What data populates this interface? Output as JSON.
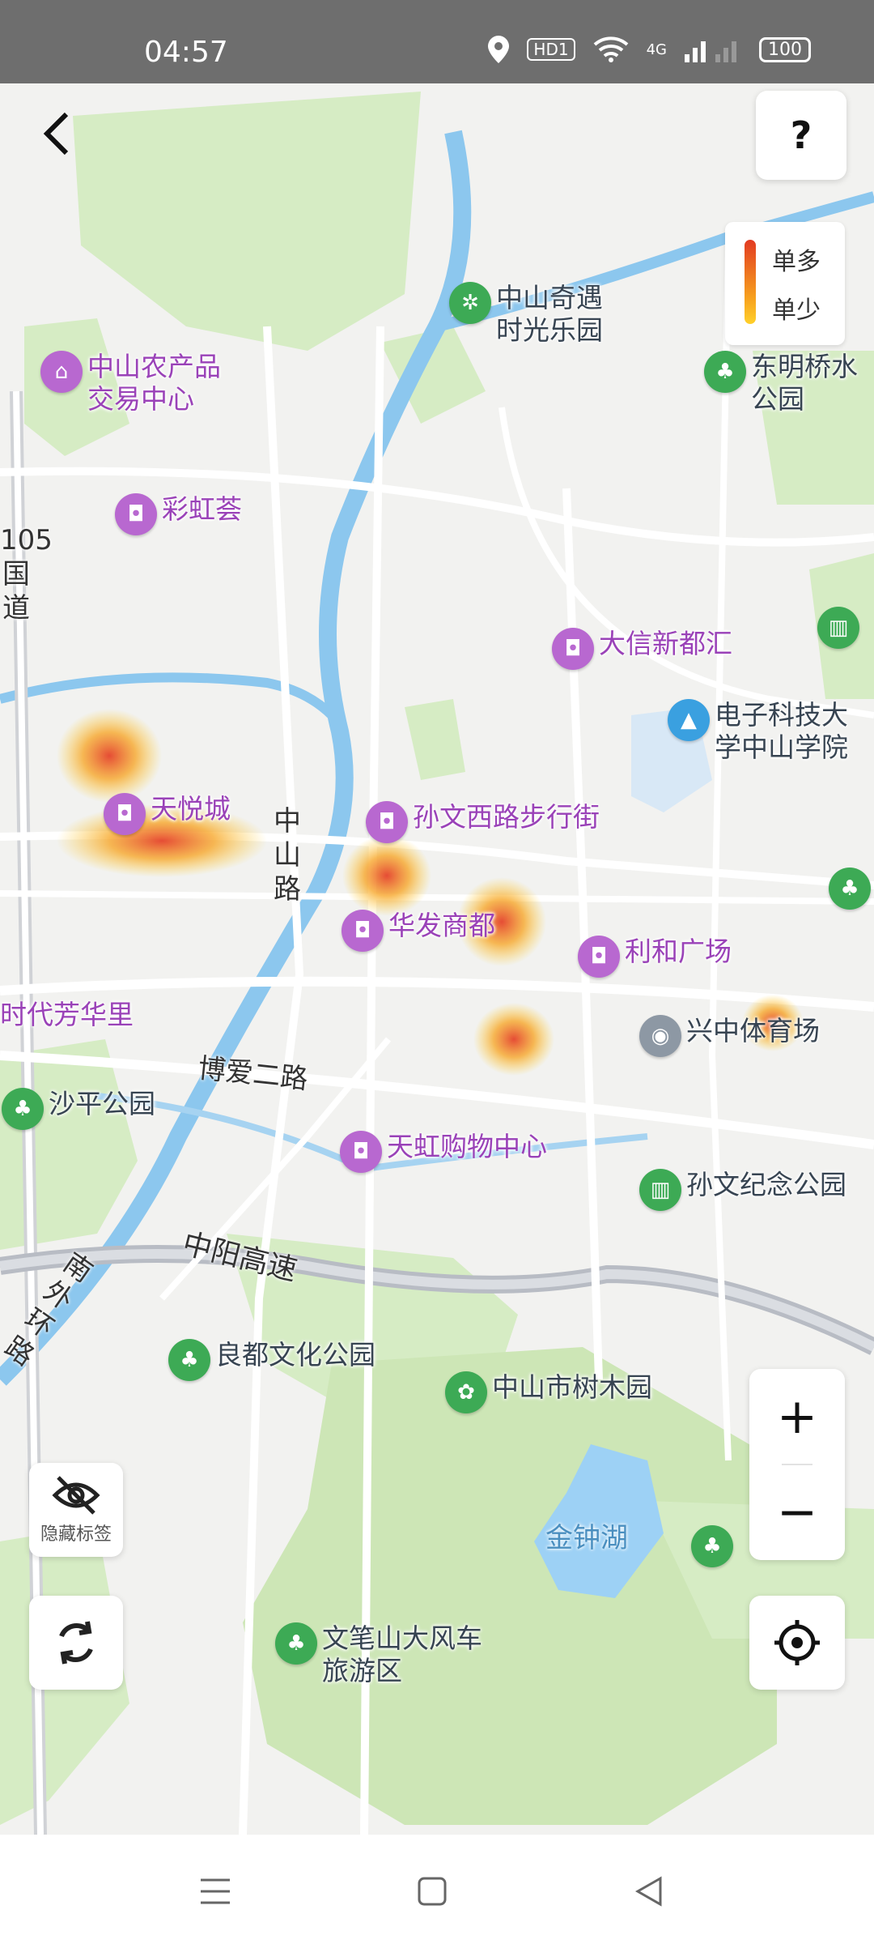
{
  "status_bar": {
    "time": "04:57",
    "hd_badge": "HD1",
    "network": "4G",
    "battery": "100",
    "icons": [
      "location-icon",
      "wifi-icon",
      "signal-icon",
      "battery-icon"
    ]
  },
  "toolbar": {
    "back_icon": "chevron-left-icon",
    "help_label": "?"
  },
  "legend": {
    "high": "单多",
    "low": "单少",
    "colors": [
      "#e23b22",
      "#f7a21e",
      "#ffd02a"
    ]
  },
  "pois": [
    {
      "label": "中山奇遇\n时光乐园",
      "type": "park",
      "icon": "ferris-wheel-icon"
    },
    {
      "label": "中山农产品\n交易中心",
      "type": "market",
      "icon": "shop-icon"
    },
    {
      "label": "东明桥水\n公园",
      "type": "park",
      "icon": "tree-icon"
    },
    {
      "label": "彩虹荟",
      "type": "shopping",
      "icon": "shopping-bag-icon"
    },
    {
      "label": "大信新都汇",
      "type": "shopping",
      "icon": "shopping-bag-icon"
    },
    {
      "label": "电子科技大\n学中山学院",
      "type": "school",
      "icon": "graduation-cap-icon"
    },
    {
      "label": "天悦城",
      "type": "shopping",
      "icon": "shopping-bag-icon"
    },
    {
      "label": "孙文西路步行街",
      "type": "shopping",
      "icon": "shopping-bag-icon"
    },
    {
      "label": "华发商都",
      "type": "shopping",
      "icon": "shopping-bag-icon"
    },
    {
      "label": "利和广场",
      "type": "shopping",
      "icon": "shopping-bag-icon"
    },
    {
      "label": "兴中体育场",
      "type": "sports",
      "icon": "stadium-icon"
    },
    {
      "label": "时代芳华里",
      "type": "area",
      "icon": ""
    },
    {
      "label": "沙平公园",
      "type": "park",
      "icon": "tree-icon"
    },
    {
      "label": "天虹购物中心",
      "type": "shopping",
      "icon": "shopping-bag-icon"
    },
    {
      "label": "孙文纪念公园",
      "type": "park",
      "icon": "monument-icon"
    },
    {
      "label": "良都文化公园",
      "type": "park",
      "icon": "tree-icon"
    },
    {
      "label": "中山市树木园",
      "type": "park",
      "icon": "arboretum-icon"
    },
    {
      "label": "文笔山大风车\n旅游区",
      "type": "park",
      "icon": "tree-icon"
    }
  ],
  "road_labels": {
    "guodao": "105国道",
    "zhongshan_road": "中山路",
    "boai_road": "博爱二路",
    "zhongyang_expressway": "中阳高速",
    "nanwaihuan": "南外环路"
  },
  "water_labels": {
    "jinzhong_lake": "金钟湖"
  },
  "heatmap": [
    {
      "level": 0.9
    },
    {
      "level": 0.7
    },
    {
      "level": 0.8
    },
    {
      "level": 0.6
    },
    {
      "level": 0.6
    },
    {
      "level": 0.4
    }
  ],
  "controls": {
    "hide_labels": "隐藏标签",
    "refresh_icon": "refresh-icon",
    "zoom_in": "+",
    "zoom_out": "−",
    "locate_icon": "crosshair-icon"
  },
  "nav_bar": {
    "menu_icon": "menu-icon",
    "home_icon": "square-icon",
    "back_icon": "triangle-back-icon"
  }
}
